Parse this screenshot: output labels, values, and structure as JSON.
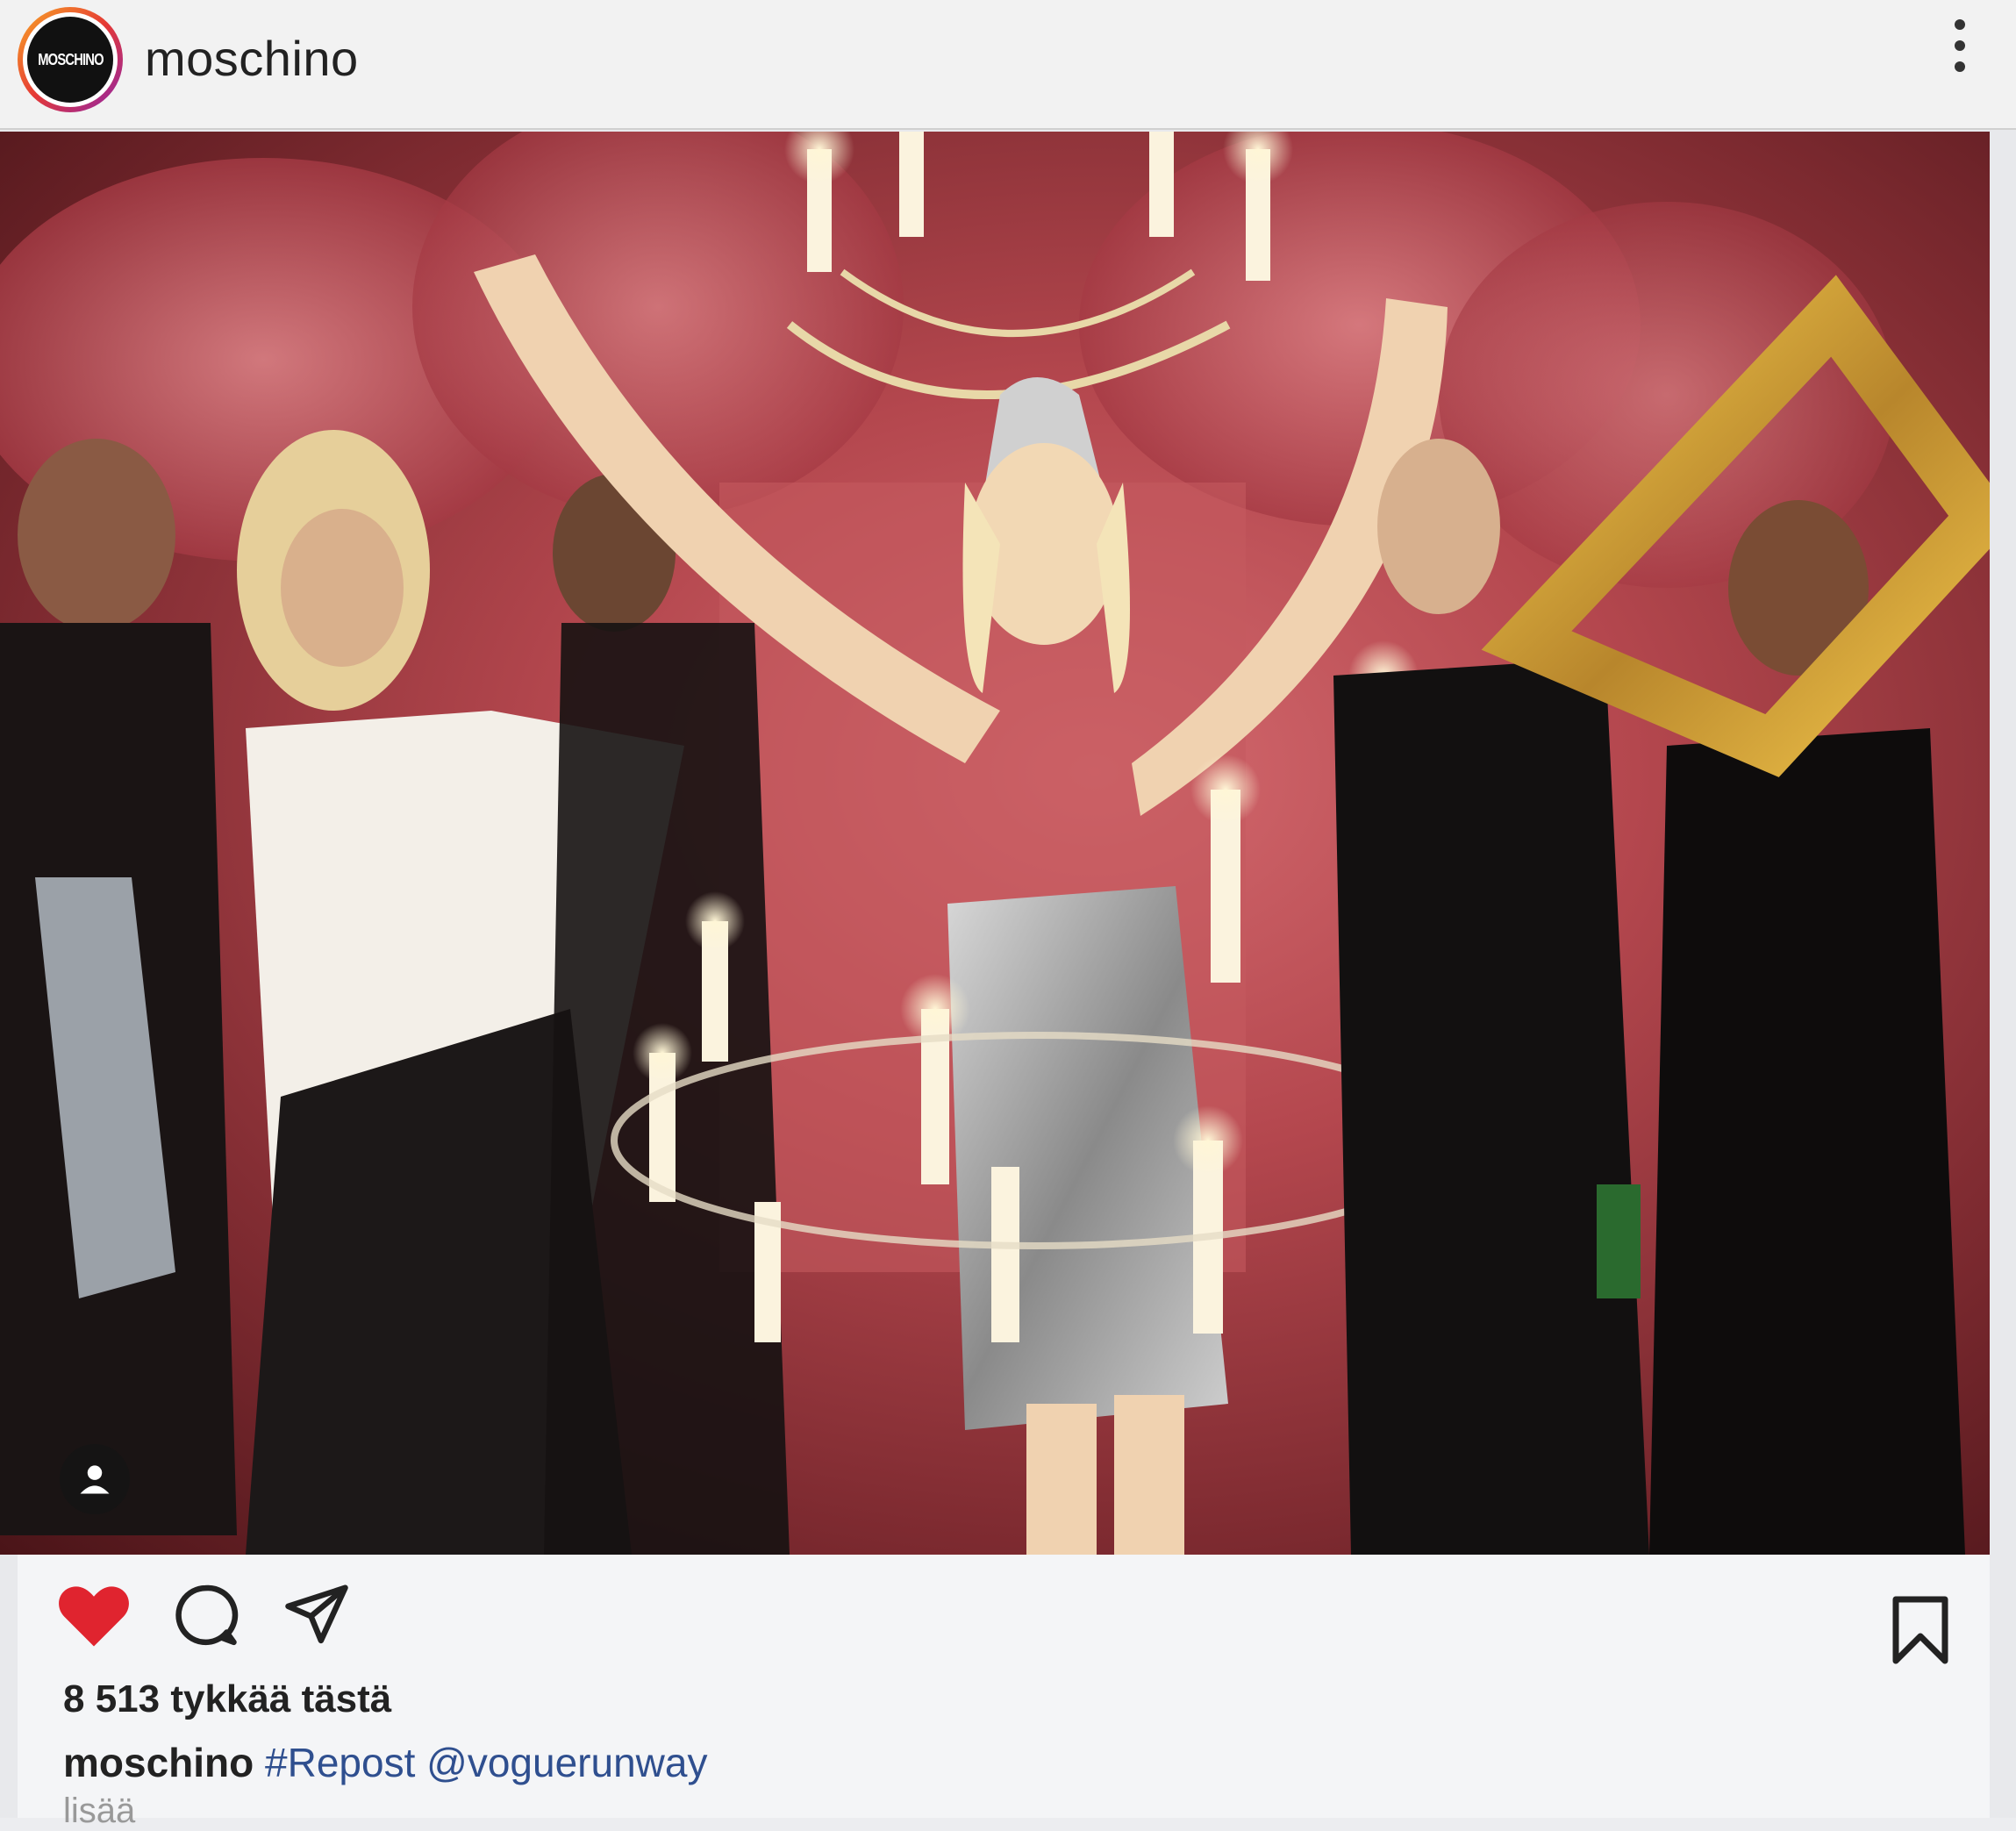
{
  "post": {
    "account": {
      "username": "moschino",
      "avatar_text": "MOSCHINO"
    },
    "menu_icon": "more-vertical-icon",
    "photo": {
      "alt": "",
      "tag_icon": "person-icon"
    },
    "actions": {
      "like_icon": "heart-filled-icon",
      "liked": true,
      "like_color": "#e0242f",
      "comment_icon": "comment-icon",
      "share_icon": "send-icon",
      "save_icon": "bookmark-icon"
    },
    "likes_text": "8 513 tykkää tästä",
    "caption": {
      "user": "moschino",
      "hashtag": "#Repost",
      "mention": "@voguerunway"
    },
    "more_text": "lisää"
  },
  "colors": {
    "link": "#2f4f8f",
    "text": "#222222"
  }
}
